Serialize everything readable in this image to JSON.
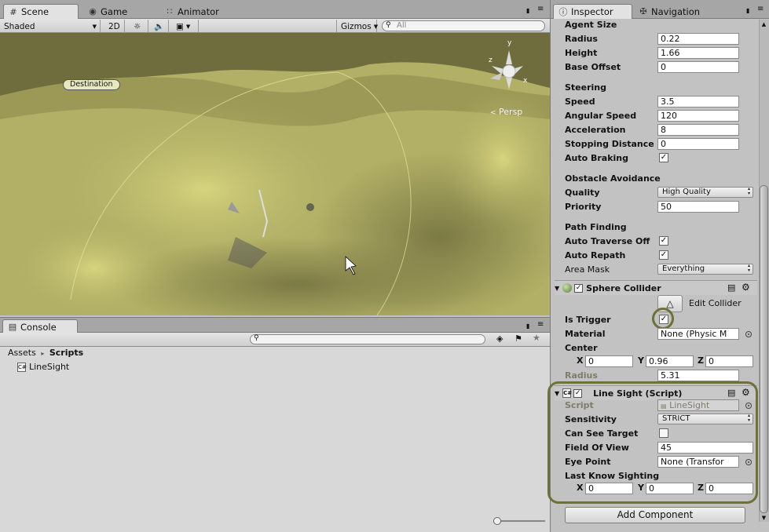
{
  "scene_tabs": {
    "scene": "Scene",
    "game": "Game",
    "animator": "Animator"
  },
  "scene_toolbar": {
    "shading": "Shaded",
    "mode_2d": "2D",
    "gizmos": "Gizmos",
    "search_placeholder": "All"
  },
  "viewport": {
    "destination_label": "Destination",
    "persp_label": "Persp",
    "axis_y": "y",
    "axis_z": "z",
    "axis_x": "x"
  },
  "console": {
    "tab": "Console"
  },
  "project": {
    "breadcrumb_root": "Assets",
    "breadcrumb_sep": "▸",
    "breadcrumb_leaf": "Scripts",
    "item": "LineSight"
  },
  "inspector_tabs": {
    "inspector": "Inspector",
    "navigation": "Navigation"
  },
  "nav_agent": {
    "agent_size_header": "Agent Size",
    "radius_label": "Radius",
    "radius": "0.22",
    "height_label": "Height",
    "height": "1.66",
    "base_offset_label": "Base Offset",
    "base_offset": "0",
    "steering_header": "Steering",
    "speed_label": "Speed",
    "speed": "3.5",
    "angular_speed_label": "Angular Speed",
    "angular_speed": "120",
    "acceleration_label": "Acceleration",
    "acceleration": "8",
    "stopping_distance_label": "Stopping Distance",
    "stopping_distance": "0",
    "auto_braking_label": "Auto Braking",
    "obstacle_header": "Obstacle Avoidance",
    "quality_label": "Quality",
    "quality": "High Quality",
    "priority_label": "Priority",
    "priority": "50",
    "path_header": "Path Finding",
    "auto_traverse_label": "Auto Traverse Off",
    "auto_repath_label": "Auto Repath",
    "area_mask_label": "Area Mask",
    "area_mask": "Everything"
  },
  "sphere_collider": {
    "title": "Sphere Collider",
    "edit_collider": "Edit Collider",
    "is_trigger_label": "Is Trigger",
    "material_label": "Material",
    "material": "None (Physic M",
    "center_label": "Center",
    "x_label": "X",
    "x": "0",
    "y_label": "Y",
    "y": "0.96",
    "z_label": "Z",
    "z": "0",
    "radius_label": "Radius",
    "radius": "5.31"
  },
  "line_sight": {
    "title": "Line Sight (Script)",
    "script_label": "Script",
    "script": "LineSight",
    "sensitivity_label": "Sensitivity",
    "sensitivity": "STRICT",
    "can_see_label": "Can See Target",
    "fov_label": "Field Of View",
    "fov": "45",
    "eye_point_label": "Eye Point",
    "eye_point": "None (Transfor",
    "last_sighting_label": "Last Know Sighting",
    "x_label": "X",
    "x": "0",
    "y_label": "Y",
    "y": "0",
    "z_label": "Z",
    "z": "0"
  },
  "add_component": "Add Component",
  "check_glyph": "✓"
}
